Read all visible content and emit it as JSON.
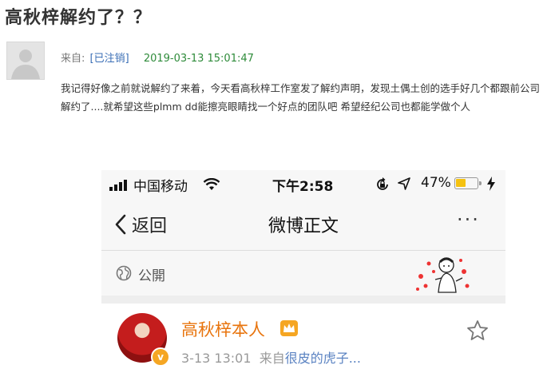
{
  "page": {
    "title": "高秋梓解约了？？"
  },
  "post": {
    "from_label": "来自:",
    "author": "[已注销]",
    "date": "2019-03-13 15:01:47",
    "body": "我记得好像之前就说解约了来着，今天看高秋梓工作室发了解约声明，发现土偶土创的选手好几个都跟前公司解约了....就希望这些plmm dd能擦亮眼睛找一个好点的团队吧 希望经纪公司也都能学做个人"
  },
  "phone": {
    "status": {
      "carrier": "中国移动",
      "time": "下午2:58",
      "battery": "47%",
      "battery_level": 0.47
    },
    "nav": {
      "back_label": "返回",
      "title": "微博正文",
      "more_label": "···"
    },
    "privacy_label": "公開",
    "weibo": {
      "user_name": "高秋梓本人",
      "time": "3-13 13:01",
      "source_prefix": "来自",
      "source": "很皮的虎子..."
    }
  },
  "colors": {
    "author_link": "#3b6fb6",
    "date": "#2e8b3a",
    "weibo_name": "#e8740d",
    "battery": "#f5c211",
    "source_link": "#5b83c2"
  },
  "icons": [
    "avatar-placeholder",
    "signal-icon",
    "wifi-icon",
    "rotation-lock-icon",
    "location-icon",
    "battery-icon",
    "charging-bolt-icon",
    "back-chevron-icon",
    "more-icon",
    "globe-icon",
    "sticker-image",
    "verified-badge-icon",
    "crown-icon",
    "star-icon"
  ]
}
